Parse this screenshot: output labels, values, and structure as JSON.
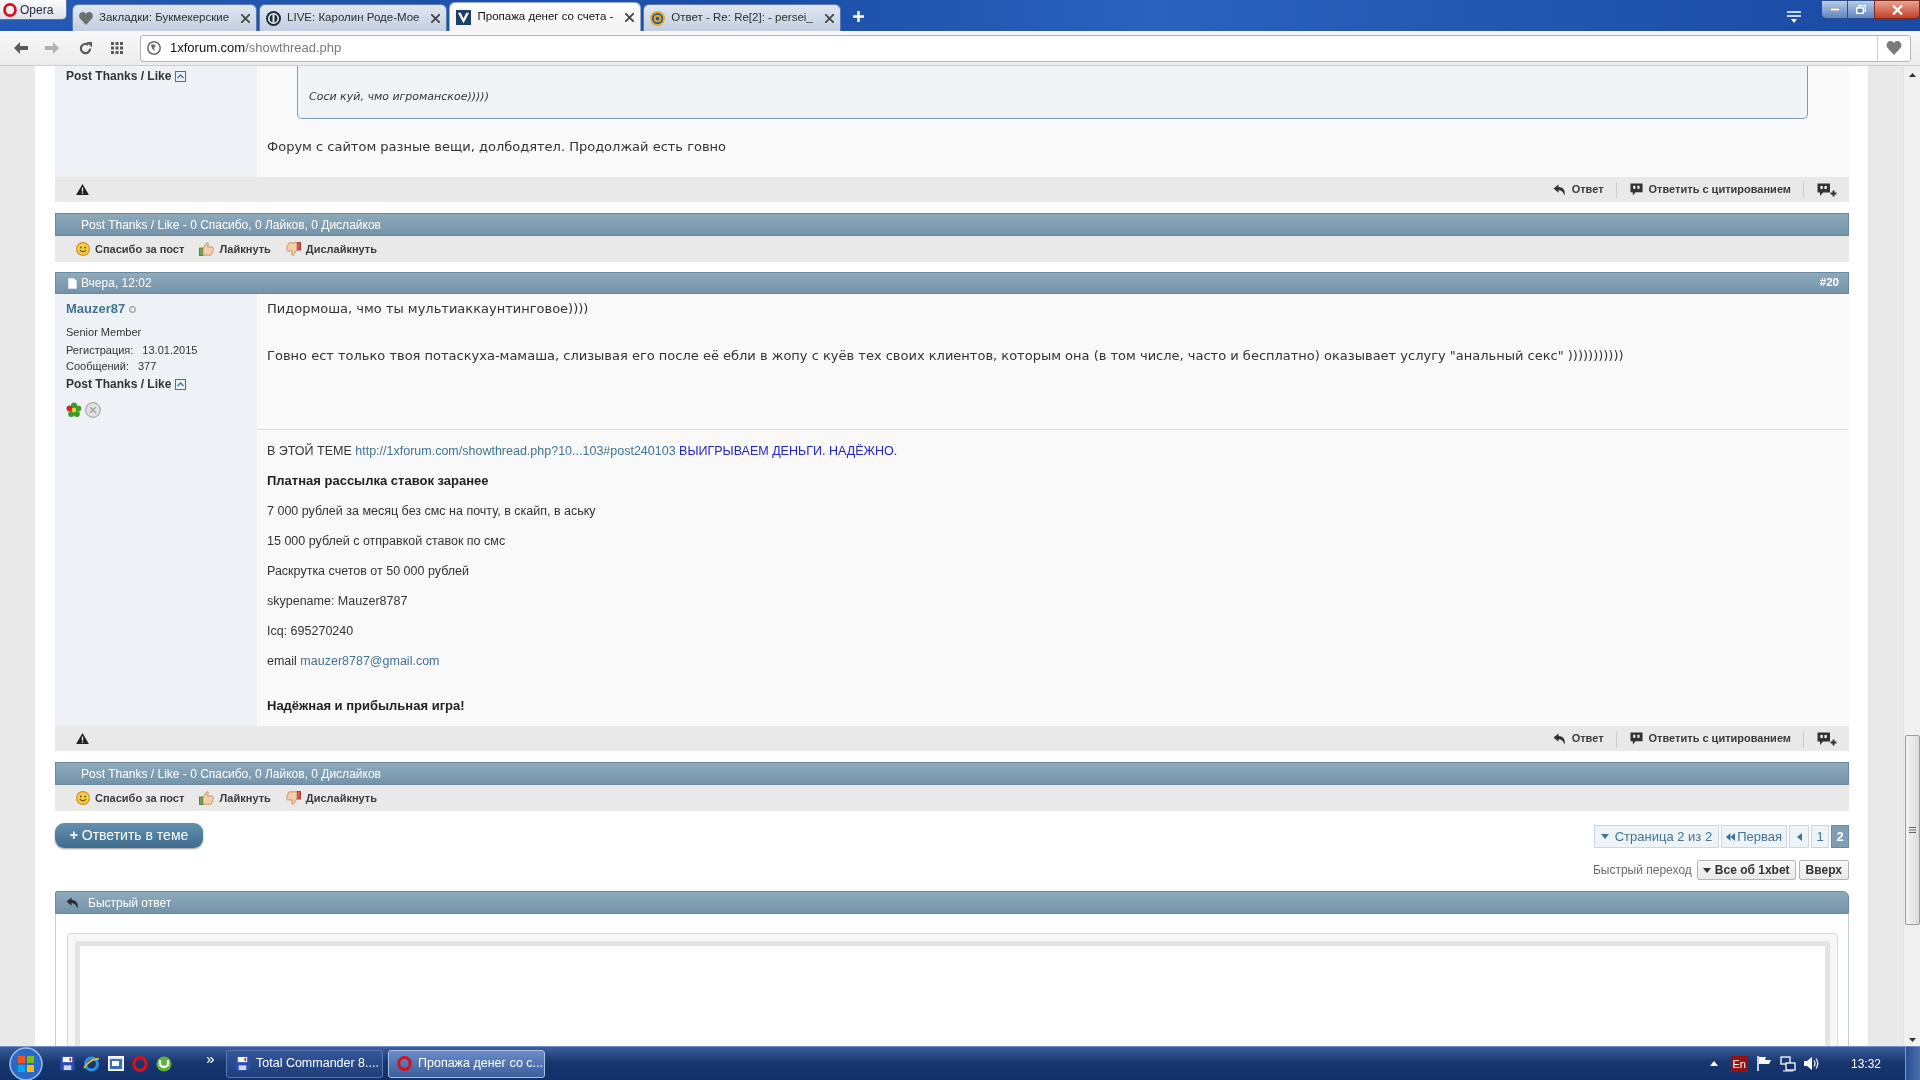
{
  "browser": {
    "menu_button": "Opera",
    "tabs": [
      {
        "kind": "bookmarks",
        "title": "Закладки: Букмекерские",
        "selected": false
      },
      {
        "kind": "live",
        "title": "LIVE: Каролин Роде-Мое",
        "selected": false
      },
      {
        "kind": "forum",
        "title": "Пропажа денег со счета -",
        "selected": true
      },
      {
        "kind": "mail",
        "title": "Ответ - Re: Re[2]: - persei_",
        "selected": false
      }
    ],
    "address": {
      "host": "1xforum.com",
      "path": "/showthread.php"
    }
  },
  "posts": [
    {
      "kind": "continued",
      "user": {
        "thanks_label": "Post Thanks / Like"
      },
      "quote": "Соси куй, чмо игроманское)))))",
      "message": [
        "Форум с сайтом разные вещи, долбодятел. Продолжай есть говно"
      ],
      "actions": [
        {
          "kind": "reply",
          "label": "Ответ"
        },
        {
          "kind": "quote",
          "label": "Ответить с цитированием"
        },
        {
          "kind": "multiquote"
        }
      ],
      "thanks": {
        "summary": "Post Thanks / Like - 0 Спасибо, 0 Лайков, 0 Дислайков",
        "buttons": [
          {
            "kind": "thanks",
            "label": "Спасибо за пост"
          },
          {
            "kind": "like",
            "label": "Лайкнуть"
          },
          {
            "kind": "dislike",
            "label": "Дислайкнуть"
          }
        ]
      }
    },
    {
      "kind": "full",
      "date": "Вчера, 12:02",
      "number": "#20",
      "user": {
        "name": "Mauzer87",
        "online": false,
        "title": "Senior Member",
        "stats": [
          {
            "label": "Регистрация:",
            "value": "13.01.2015"
          },
          {
            "label": "Сообщений:",
            "value": "377"
          }
        ],
        "thanks_label": "Post Thanks / Like"
      },
      "message": [
        "Пидормоша, чмо ты мультиаккаунтинговое))))",
        "Говно ест только твоя потаскуха-мамаша, слизывая его после её ебли в жопу с куёв тех своих клиентов, которым она (в том числе, часто и бесплатно) оказывает услугу \"анальный секс\" )))))))))))"
      ],
      "signature": [
        {
          "kind": "text",
          "parts": [
            {
              "kind": "text",
              "text": "В ЭТОЙ ТЕМЕ"
            },
            {
              "kind": "link",
              "text": "http://1xforum.com/showthread.php?10...103#post240103"
            },
            {
              "kind": "highlight",
              "text": "ВЫИГРЫВАЕМ ДЕНЬГИ. НАДЁЖНО."
            }
          ]
        },
        {
          "kind": "heading",
          "parts": [
            {
              "kind": "text",
              "text": "Платная рассылка ставок заранее"
            }
          ]
        },
        {
          "kind": "text",
          "parts": [
            {
              "kind": "text",
              "text": "7 000 рублей за месяц без смс на почту, в скайп, в аську"
            }
          ]
        },
        {
          "kind": "text",
          "parts": [
            {
              "kind": "text",
              "text": "15 000 рублей с отправкой ставок по смс"
            }
          ]
        },
        {
          "kind": "text",
          "parts": [
            {
              "kind": "text",
              "text": "Раскрутка счетов от 50 000 рублей"
            }
          ]
        },
        {
          "kind": "text",
          "parts": [
            {
              "kind": "text",
              "text": "skypename: Mauzer8787"
            }
          ]
        },
        {
          "kind": "text",
          "parts": [
            {
              "kind": "text",
              "text": "Icq: 695270240"
            }
          ]
        },
        {
          "kind": "text",
          "parts": [
            {
              "kind": "text",
              "text": "email"
            },
            {
              "kind": "link",
              "text": "mauzer8787@gmail.com"
            }
          ]
        },
        {
          "kind": "closing",
          "parts": [
            {
              "kind": "text",
              "text": "Надёжная и прибыльная игра!"
            }
          ]
        }
      ],
      "actions": [
        {
          "kind": "reply",
          "label": "Ответ"
        },
        {
          "kind": "quote",
          "label": "Ответить с цитированием"
        },
        {
          "kind": "multiquote"
        }
      ],
      "thanks": {
        "summary": "Post Thanks / Like - 0 Спасибо, 0 Лайков, 0 Дислайков",
        "buttons": [
          {
            "kind": "thanks",
            "label": "Спасибо за пост"
          },
          {
            "kind": "like",
            "label": "Лайкнуть"
          },
          {
            "kind": "dislike",
            "label": "Дислайкнуть"
          }
        ]
      }
    }
  ],
  "reply_button": "**+** Ответить в теме",
  "pagination": {
    "label": "Страница 2 из 2",
    "first": "Первая",
    "pages": [
      {
        "label": "1",
        "selected": false
      },
      {
        "label": "2",
        "selected": true
      }
    ]
  },
  "quick_nav": {
    "label": "Быстрый переход",
    "forum": "Все об 1xbet",
    "top": "Вверх"
  },
  "quick_reply": {
    "title": "Быстрый ответ"
  },
  "taskbar": {
    "tasks": [
      {
        "kind": "file-manager",
        "label": "Total Commander 8....",
        "selected": false
      },
      {
        "kind": "browser",
        "label": "Пропажа денег со с...",
        "selected": true
      }
    ],
    "language": "En",
    "time": "13:32"
  }
}
